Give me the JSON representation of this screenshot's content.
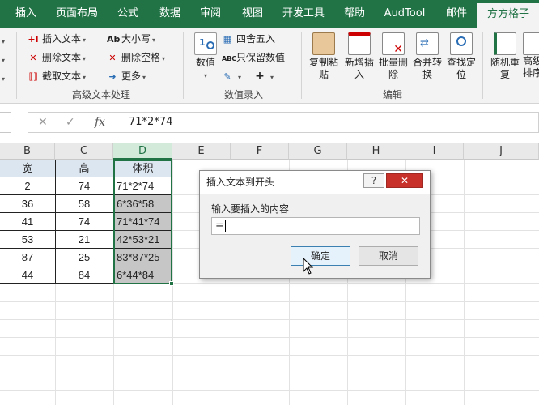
{
  "ribbon_tabs": [
    "插入",
    "页面布局",
    "公式",
    "数据",
    "审阅",
    "视图",
    "开发工具",
    "帮助",
    "AudTool",
    "邮件",
    "方方格子"
  ],
  "active_tab": "方方格子",
  "ribbon": {
    "text_group": {
      "insert_text": "插入文本",
      "delete_text": "删除文本",
      "extract_text": "截取文本",
      "case": "大小写",
      "delete_space": "删除空格",
      "more": "更多",
      "label": "高级文本处理"
    },
    "numeric_group": {
      "numeric": "数值",
      "round": "四舍五入",
      "keep_value": "只保留数值",
      "label": "数值录入"
    },
    "edit_group": {
      "copy_paste": "复制粘贴",
      "add_insert": "新增插入",
      "batch_delete": "批量删除",
      "merge_convert": "合并转换",
      "find_locate": "查找定位",
      "label": "编辑"
    },
    "extra": {
      "random": "随机重复",
      "advanced": "高级排序"
    }
  },
  "formula_bar": {
    "cancel_glyph": "✕",
    "confirm_glyph": "✓",
    "fx_glyph": "fx",
    "value": "71*2*74"
  },
  "sheet": {
    "columns": [
      "B",
      "C",
      "D",
      "E",
      "F",
      "G",
      "H",
      "I",
      "J"
    ],
    "selected_column": "D",
    "headers": [
      "宽",
      "高",
      "体积"
    ],
    "rows": [
      [
        "2",
        "74",
        "71*2*74"
      ],
      [
        "36",
        "58",
        "6*36*58"
      ],
      [
        "41",
        "74",
        "71*41*74"
      ],
      [
        "53",
        "21",
        "42*53*21"
      ],
      [
        "87",
        "25",
        "83*87*25"
      ],
      [
        "44",
        "84",
        "6*44*84"
      ]
    ]
  },
  "dialog": {
    "title": "插入文本到开头",
    "help": "?",
    "close": "✕",
    "prompt": "输入要插入的内容",
    "input_value": "=",
    "ok": "确定",
    "cancel": "取消"
  },
  "colors": {
    "excel_green": "#217346",
    "selection_gray": "#c6c6c6",
    "header_fill": "#dce6f1",
    "close_red": "#c7312a"
  }
}
